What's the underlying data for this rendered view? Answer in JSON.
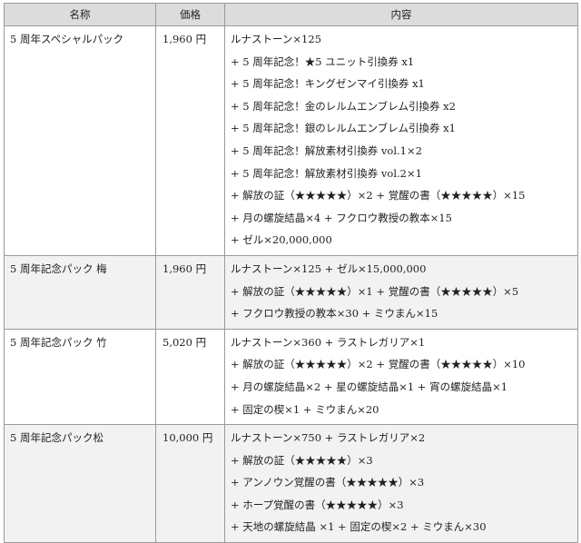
{
  "headers": {
    "name": "名称",
    "price": "価格",
    "content": "内容"
  },
  "rows": [
    {
      "name": "5 周年スペシャルパック",
      "price": "1,960 円",
      "lines": [
        "ルナストーン×125",
        "+ 5 周年記念！★5 ユニット引換券 x1",
        "+ 5 周年記念！キングゼンマイ引換券 x1",
        "+ 5 周年記念！金のレルムエンブレム引換券 x2",
        "+ 5 周年記念！銀のレルムエンブレム引換券 x1",
        "+ 5 周年記念！解放素材引換券 vol.1×2",
        "+ 5 周年記念！解放素材引換券 vol.2×1",
        "+ 解放の証（★★★★★）×2 + 覚醒の書（★★★★★）×15",
        "+ 月の螺旋結晶×4 + フクロウ教授の教本×15",
        "+ ゼル×20,000,000"
      ]
    },
    {
      "name": "5 周年記念パック 梅",
      "price": "1,960 円",
      "lines": [
        "ルナストーン×125 + ゼル×15,000,000",
        "+ 解放の証（★★★★★）×1 + 覚醒の書（★★★★★）×5",
        "+ フクロウ教授の教本×30 + ミウまん×15"
      ]
    },
    {
      "name": "5 周年記念パック 竹",
      "price": "5,020 円",
      "lines": [
        "ルナストーン×360 + ラストレガリア×1",
        "+ 解放の証（★★★★★）×2 + 覚醒の書（★★★★★）×10",
        "+ 月の螺旋結晶×2 + 星の螺旋結晶×1 + 宵の螺旋結晶×1",
        "+ 固定の楔×1 + ミウまん×20"
      ]
    },
    {
      "name": "5 周年記念パック松",
      "price": "10,000 円",
      "lines": [
        "ルナストーン×750 + ラストレガリア×2",
        "+ 解放の証（★★★★★）×3",
        "+ アンノウン覚醒の書（★★★★★）×3",
        "+ ホープ覚醒の書（★★★★★）×3",
        "+ 天地の螺旋結晶 ×1 + 固定の楔×2 + ミウまん×30"
      ]
    }
  ]
}
